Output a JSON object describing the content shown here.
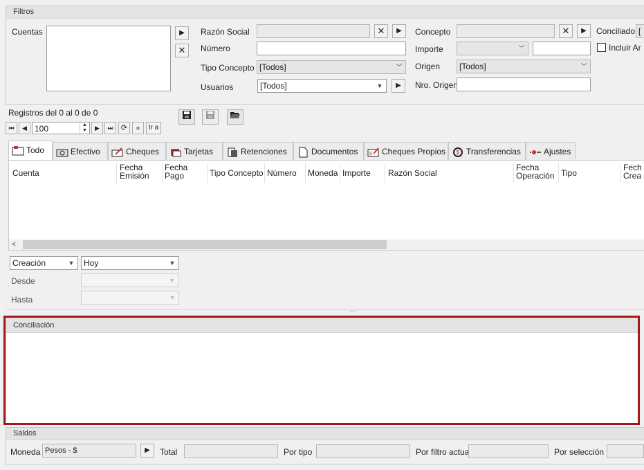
{
  "filtros": {
    "title": "Filtros",
    "cuentas_label": "Cuentas",
    "razon_social_label": "Razón Social",
    "numero_label": "Número",
    "tipo_concepto_label": "Tipo Concepto",
    "tipo_concepto_value": "[Todos]",
    "usuarios_label": "Usuarios",
    "usuarios_value": "[Todos]",
    "concepto_label": "Concepto",
    "importe_label": "Importe",
    "origen_label": "Origen",
    "origen_value": "[Todos]",
    "nro_origen_label": "Nro. Origen",
    "conciliado_label": "Conciliado",
    "conciliado_value": "[",
    "incluir_label": "Incluir Ar"
  },
  "registros": {
    "text": "Registros del 0 al 0 de 0",
    "page_size": "100",
    "ir_a_label": "Ir a"
  },
  "tabs": [
    {
      "label": "Todo",
      "icon": "all-icon"
    },
    {
      "label": "Efectivo",
      "icon": "cash-icon"
    },
    {
      "label": "Cheques",
      "icon": "check-icon"
    },
    {
      "label": "Tarjetas",
      "icon": "card-icon"
    },
    {
      "label": "Retenciones",
      "icon": "retention-icon"
    },
    {
      "label": "Documentos",
      "icon": "document-icon"
    },
    {
      "label": "Cheques Propios",
      "icon": "own-check-icon"
    },
    {
      "label": "Transferencias",
      "icon": "transfer-icon"
    },
    {
      "label": "Ajustes",
      "icon": "adjust-icon"
    }
  ],
  "grid": {
    "columns": [
      "Cuenta",
      "Fecha\nEmisión",
      "Fecha\nPago",
      "Tipo Concepto",
      "Número",
      "Moneda",
      "Importe",
      "Razón Social",
      "Fecha\nOperación",
      "Tipo",
      "Fech\nCrea"
    ]
  },
  "date_filter": {
    "field_value": "Creación",
    "period_value": "Hoy",
    "desde_label": "Desde",
    "hasta_label": "Hasta"
  },
  "conciliacion": {
    "title": "Conciliación"
  },
  "saldos": {
    "title": "Saldos",
    "moneda_label": "Moneda",
    "moneda_value": "Pesos - $",
    "total_label": "Total",
    "por_tipo_label": "Por tipo",
    "por_filtro_label": "Por filtro actual",
    "por_seleccion_label": "Por selección"
  },
  "colors": {
    "highlight_border": "#a31a1a",
    "panel_bg": "#f0f0f0",
    "title_bg": "#e3e3e3"
  }
}
